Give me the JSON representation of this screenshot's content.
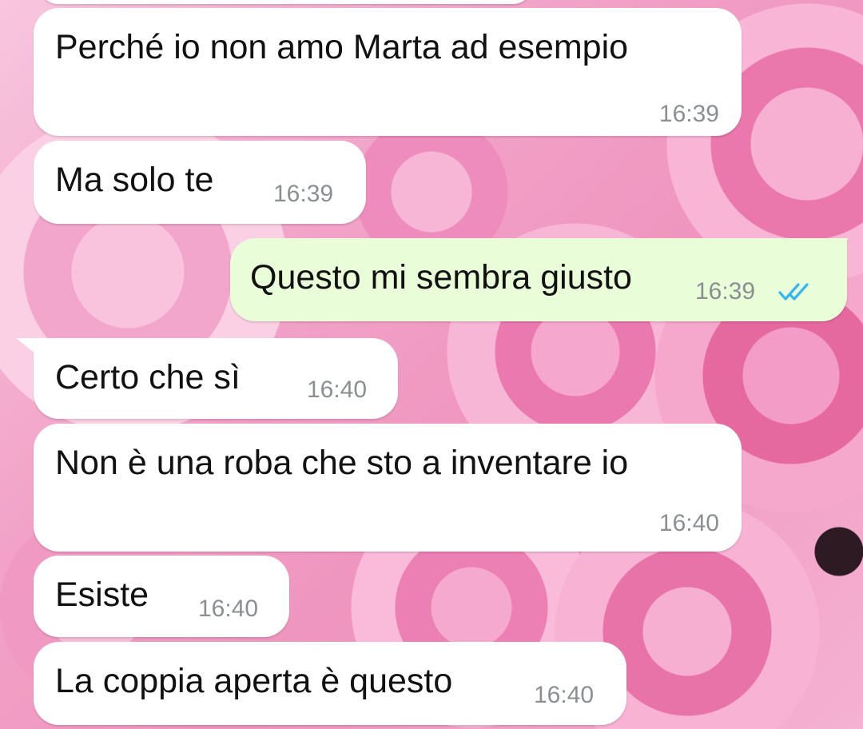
{
  "chat": {
    "messages": [
      {
        "dir": "in",
        "text": "Perché io non amo Marta ad esempio",
        "time": "16:39"
      },
      {
        "dir": "in",
        "text": "Ma solo te",
        "time": "16:39"
      },
      {
        "dir": "out",
        "text": "Questo mi sembra giusto",
        "time": "16:39",
        "status": "read"
      },
      {
        "dir": "in",
        "text": "Certo che sì",
        "time": "16:40"
      },
      {
        "dir": "in",
        "text": "Non è una roba che sto a inventare io",
        "time": "16:40"
      },
      {
        "dir": "in",
        "text": "Esiste",
        "time": "16:40"
      },
      {
        "dir": "in",
        "text": "La coppia aperta è questo",
        "time": "16:40"
      }
    ]
  },
  "colors": {
    "incoming_bubble": "#ffffff",
    "outgoing_bubble": "#e8fdd8",
    "read_ticks": "#34b7f1",
    "timestamp": "#8a8f92"
  },
  "icons": {
    "read_receipt": "double-check-icon"
  }
}
